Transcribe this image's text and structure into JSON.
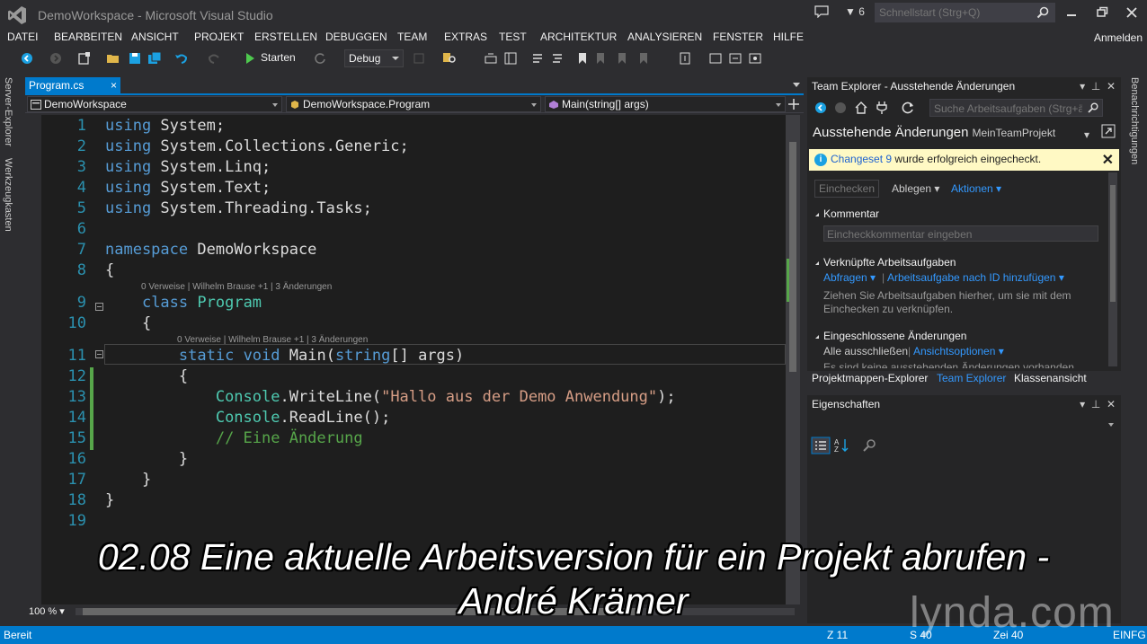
{
  "window": {
    "title": "DemoWorkspace - Microsoft Visual Studio"
  },
  "titlebar": {
    "filter_count": "6",
    "quicklaunch_placeholder": "Schnellstart (Strg+Q)"
  },
  "menu": {
    "items": [
      "DATEI",
      "BEARBEITEN",
      "ANSICHT",
      "PROJEKT",
      "ERSTELLEN",
      "DEBUGGEN",
      "TEAM",
      "EXTRAS",
      "TEST",
      "ARCHITEKTUR",
      "ANALYSIEREN",
      "FENSTER",
      "HILFE"
    ],
    "signin": "Anmelden"
  },
  "toolbar": {
    "start_label": "Starten",
    "configuration": "Debug"
  },
  "left_strip": {
    "server_explorer": "Server-Explorer",
    "toolbox": "Werkzeugkasten"
  },
  "right_strip": {
    "notifications": "Benachrichtigungen"
  },
  "editor": {
    "tab": {
      "name": "Program.cs",
      "close": "×"
    },
    "nav": {
      "project": "DemoWorkspace",
      "class": "DemoWorkspace.Program",
      "member": "Main(string[] args)"
    },
    "zoom": "100 %",
    "codelens_class": "0 Verweise | Wilhelm Brause +1 | 3 Änderungen",
    "codelens_method": "0 Verweise | Wilhelm Brause +1 | 3 Änderungen",
    "line_numbers": [
      "1",
      "2",
      "3",
      "4",
      "5",
      "6",
      "7",
      "8",
      "9",
      "10",
      "11",
      "12",
      "13",
      "14",
      "15",
      "16",
      "17",
      "18",
      "19"
    ]
  },
  "team_explorer": {
    "header": "Team Explorer - Ausstehende Änderungen",
    "search_placeholder": "Suche Arbeitsaufgaben (Strg+ä)",
    "page_title": "Ausstehende Änderungen",
    "project": "MeinTeamProjekt",
    "info": {
      "link": "Changeset 9",
      "text": " wurde erfolgreich eingecheckt."
    },
    "checkin_button": "Einchecken",
    "shelve": "Ablegen",
    "actions": "Aktionen",
    "comment_section": "Kommentar",
    "comment_placeholder": "Eincheckkommentar eingeben",
    "linked_section": "Verknüpfte Arbeitsaufgaben",
    "query_link": "Abfragen",
    "add_by_id_link": "Arbeitsaufgabe nach ID hinzufügen",
    "drag_hint_1": "Ziehen Sie Arbeitsaufgaben hierher, um sie mit dem",
    "drag_hint_2": "Einchecken zu verknüpfen.",
    "included_section": "Eingeschlossene Änderungen",
    "exclude_all": "Alle ausschließen",
    "view_options": "Ansichtsoptionen",
    "cut_text": "Es sind keine ausstehenden Änderungen vorhanden.",
    "tabs": [
      "Projektmappen-Explorer",
      "Team Explorer",
      "Klassenansicht"
    ]
  },
  "properties": {
    "header": "Eigenschaften"
  },
  "statusbar": {
    "state": "Bereit",
    "line": "Z 11",
    "col": "S 40",
    "char": "Zei 40",
    "mode": "EINFG"
  },
  "subtitle": {
    "line1": "02.08 Eine aktuelle Arbeitsversion für ein Projekt abrufen -",
    "line2": "André Krämer"
  },
  "watermark": "lynda.com",
  "colors": {
    "accent": "#007acc",
    "keyword": "#569cd6",
    "type": "#4ec9b0",
    "string": "#d69d85",
    "comment": "#57a64a",
    "line_number": "#2b91af",
    "background": "#1e1e1e"
  }
}
